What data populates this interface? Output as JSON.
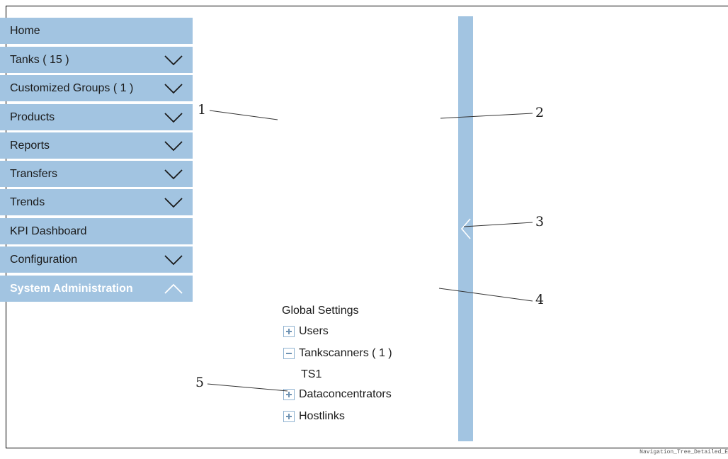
{
  "nav": {
    "items": [
      {
        "label": "Home",
        "expandable": false
      },
      {
        "label": "Tanks ( 15 )",
        "expandable": true
      },
      {
        "label": "Customized Groups ( 1 )",
        "expandable": true
      },
      {
        "label": "Products",
        "expandable": true
      },
      {
        "label": "Reports",
        "expandable": true
      },
      {
        "label": "Transfers",
        "expandable": true
      },
      {
        "label": "Trends",
        "expandable": true
      },
      {
        "label": "KPI Dashboard",
        "expandable": false
      },
      {
        "label": "Configuration",
        "expandable": true
      },
      {
        "label": "System Administration",
        "expandable": true,
        "expanded": true
      }
    ]
  },
  "subtree": {
    "heading": "Global Settings",
    "users": "Users",
    "tankscanners": "Tankscanners ( 1 )",
    "ts1": "TS1",
    "dataconcentrators": "Dataconcentrators",
    "hostlinks": "Hostlinks"
  },
  "callouts": [
    "1",
    "2",
    "3",
    "4",
    "5"
  ],
  "footer_id": "Navigation_Tree_Detailed_E",
  "colors": {
    "nav_bg": "#a2c4e1",
    "active_text": "#ffffff"
  }
}
